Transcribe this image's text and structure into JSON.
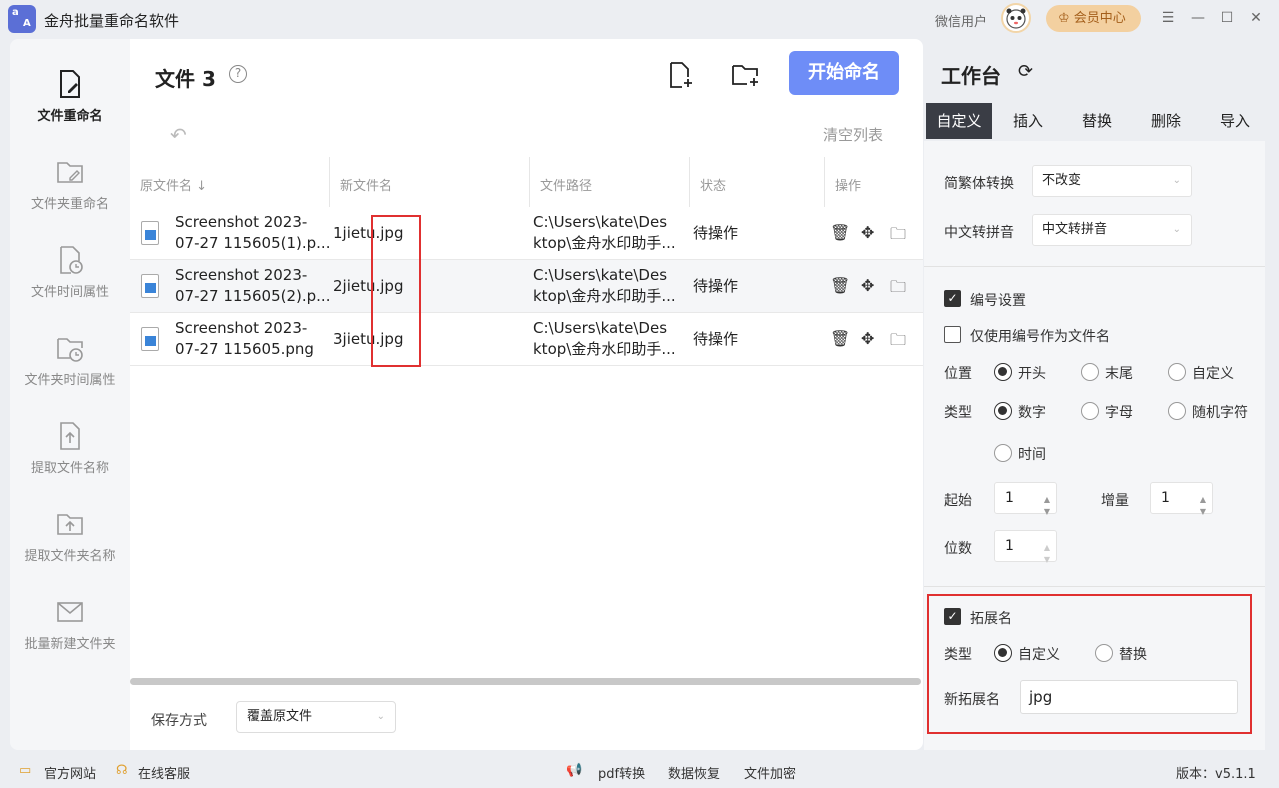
{
  "app": {
    "title": "金舟批量重命名软件",
    "wx_user": "微信用户",
    "vip_label": "会员中心"
  },
  "sidebar": {
    "items": [
      {
        "label": "文件重命名",
        "icon": "file-edit-icon"
      },
      {
        "label": "文件夹重命名",
        "icon": "folder-edit-icon"
      },
      {
        "label": "文件时间属性",
        "icon": "file-clock-icon"
      },
      {
        "label": "文件夹时间属性",
        "icon": "folder-clock-icon"
      },
      {
        "label": "提取文件名称",
        "icon": "file-upload-icon"
      },
      {
        "label": "提取文件夹名称",
        "icon": "folder-upload-icon"
      },
      {
        "label": "批量新建文件夹",
        "icon": "mail-folder-icon"
      }
    ]
  },
  "main": {
    "title": "文件 3",
    "start_button": "开始命名",
    "clear_list": "清空列表",
    "columns": [
      "原文件名 ↓",
      "新文件名",
      "文件路径",
      "状态",
      "操作"
    ],
    "rows": [
      {
        "orig_1": "Screenshot 2023-",
        "orig_2": "07-27 115605(1).p...",
        "new": "1jietu.jpg",
        "path_1": "C:\\Users\\kate\\Des",
        "path_2": "ktop\\金舟水印助手...",
        "status": "待操作"
      },
      {
        "orig_1": "Screenshot 2023-",
        "orig_2": "07-27 115605(2).p...",
        "new": "2jietu.jpg",
        "path_1": "C:\\Users\\kate\\Des",
        "path_2": "ktop\\金舟水印助手...",
        "status": "待操作"
      },
      {
        "orig_1": "Screenshot 2023-",
        "orig_2": "07-27 115605.png",
        "new": "3jietu.jpg",
        "path_1": "C:\\Users\\kate\\Des",
        "path_2": "ktop\\金舟水印助手...",
        "status": "待操作"
      }
    ],
    "save_label": "保存方式",
    "save_value": "覆盖原文件"
  },
  "workbench": {
    "title": "工作台",
    "tabs": [
      "自定义",
      "插入",
      "替换",
      "删除",
      "导入"
    ],
    "active_tab": "自定义",
    "trad_label": "简繁体转换",
    "trad_value": "不改变",
    "pinyin_label": "中文转拼音",
    "pinyin_value": "中文转拼音",
    "numbering": {
      "enabled_label": "编号设置",
      "enabled": true,
      "only_label": "仅使用编号作为文件名",
      "only": false,
      "position_label": "位置",
      "position_options": [
        "开头",
        "末尾",
        "自定义"
      ],
      "position_selected": "开头",
      "type_label": "类型",
      "type_options": [
        "数字",
        "字母",
        "随机字符",
        "时间"
      ],
      "type_selected": "数字",
      "start_label": "起始",
      "start_value": "1",
      "increment_label": "增量",
      "increment_value": "1",
      "digits_label": "位数",
      "digits_value": "1"
    },
    "extension": {
      "enabled_label": "拓展名",
      "enabled": true,
      "type_label": "类型",
      "type_options": [
        "自定义",
        "替换"
      ],
      "type_selected": "自定义",
      "new_ext_label": "新拓展名",
      "new_ext_value": "jpg"
    }
  },
  "statusbar": {
    "website": "官方网站",
    "service": "在线客服",
    "pdf": "pdf转换",
    "recovery": "数据恢复",
    "encrypt": "文件加密",
    "version": "版本：v5.1.1"
  },
  "colors": {
    "accent": "#6e8df7",
    "highlight_box": "#e03030",
    "vip": "#f3d0a0"
  }
}
